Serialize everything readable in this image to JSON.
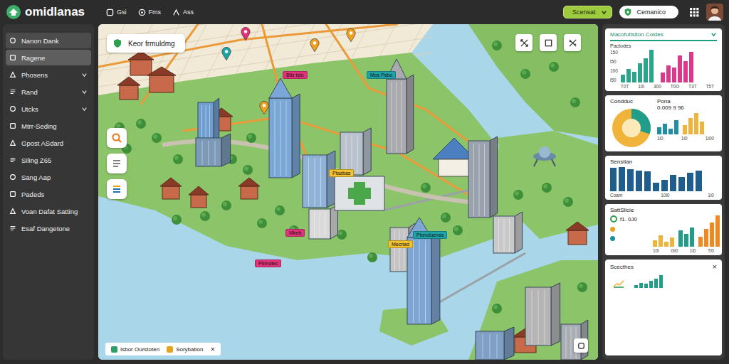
{
  "app": {
    "name": "omidlanas"
  },
  "nav": [
    {
      "label": "Gsi"
    },
    {
      "label": "Fms"
    },
    {
      "label": "Ass"
    }
  ],
  "header": {
    "scenario": {
      "label": "Scensat",
      "expanded": false
    },
    "status": "Cemanico"
  },
  "sidebar": {
    "items": [
      {
        "label": "Nanon Dank",
        "selected": false,
        "highlighted": true,
        "expandable": false
      },
      {
        "label": "Ragene",
        "selected": true,
        "highlighted": false,
        "expandable": false
      },
      {
        "label": "Phosens",
        "selected": false,
        "highlighted": false,
        "expandable": true
      },
      {
        "label": "Rand",
        "selected": false,
        "highlighted": false,
        "expandable": true
      },
      {
        "label": "Utcks",
        "selected": false,
        "highlighted": false,
        "expandable": true
      },
      {
        "label": "Mtrr-Seding",
        "selected": false,
        "highlighted": false,
        "expandable": false
      },
      {
        "label": "Gpost ASdard",
        "selected": false,
        "highlighted": false,
        "expandable": false
      },
      {
        "label": "Siling Z65",
        "selected": false,
        "highlighted": false,
        "expandable": false
      },
      {
        "label": "Sang Aap",
        "selected": false,
        "highlighted": false,
        "expandable": false
      },
      {
        "label": "Padeds",
        "selected": false,
        "highlighted": false,
        "expandable": false
      },
      {
        "label": "Voan Dafat Satting",
        "selected": false,
        "highlighted": false,
        "expandable": false
      },
      {
        "label": "Esaf Dangetone",
        "selected": false,
        "highlighted": false,
        "expandable": false
      }
    ]
  },
  "map": {
    "search": "Keor frmuldmg",
    "labels": [
      {
        "text": "Bitz tsio",
        "color": "#e0337a"
      },
      {
        "text": "Mos Psbo",
        "color": "#1fa3a8"
      },
      {
        "text": "Ptazbas",
        "color": "#f2c230"
      },
      {
        "text": "Mkeb",
        "color": "#e0337a"
      },
      {
        "text": "Pkrnolec",
        "color": "#e0337a"
      },
      {
        "text": "Pionoluenss",
        "color": "#1fa3a8"
      },
      {
        "text": "Mecnad",
        "color": "#f2c230"
      }
    ],
    "pins": [
      {
        "color": "#e0337a"
      },
      {
        "color": "#1fa3a8"
      },
      {
        "color": "#f0a020"
      },
      {
        "color": "#f0a020"
      },
      {
        "color": "#f0a020"
      }
    ],
    "legend": [
      {
        "label": "Isbor Ourstoten",
        "color": "#2e9e6a"
      },
      {
        "label": "Sorybation",
        "color": "#e8a21b"
      }
    ],
    "legend_close": "×"
  },
  "panels": {
    "overview": {
      "title": "Macofuttsiton Coldes",
      "expanded": false,
      "subtitle": "Pactodes",
      "y_ticks": [
        "150",
        "l50",
        "100",
        "l50"
      ],
      "x_ticks": [
        "T0T",
        "1I0",
        "300",
        "T0O",
        "T3T",
        "T5T"
      ],
      "series": [
        {
          "color": "#2aa58a",
          "values": [
            20,
            35,
            28,
            50,
            62,
            85
          ]
        },
        {
          "color": "#d93a8c",
          "values": [
            25,
            45,
            38,
            70,
            55,
            80
          ]
        }
      ]
    },
    "distribution": {
      "title": "Condduc",
      "donut": {
        "level": 0.3
      },
      "metric_label": "Pona",
      "metric_value": "0.009 9 96",
      "x_ticks": [
        "1l0",
        "1l0",
        "1l00"
      ],
      "series": [
        {
          "color": "#1f8fa5",
          "values": [
            30,
            45,
            25,
            60
          ]
        },
        {
          "color": "#f0b43a",
          "values": [
            40,
            70,
            90,
            55
          ]
        }
      ]
    },
    "sessions": {
      "title": "Senstian",
      "x_ticks": [
        "Coam",
        "10l0",
        "1l0"
      ],
      "series": [
        {
          "color": "#1f5e8c",
          "values": [
            80,
            82,
            76,
            70,
            68,
            30,
            40,
            55,
            48,
            62,
            70
          ]
        }
      ]
    },
    "statistics": {
      "title": "SattSlicie",
      "reading": {
        "text": "f1. 0J0",
        "color": "#2e9e4f"
      },
      "markers": [
        {
          "color": "#e8a21b"
        },
        {
          "color": "#1f8fa5"
        }
      ],
      "x_ticks": [
        "10l",
        "Gl0",
        "1l0",
        "Tl0"
      ],
      "series": [
        {
          "color": "#f0b43a",
          "values": [
            20,
            35,
            15,
            28
          ]
        },
        {
          "color": "#1f9e8a",
          "values": [
            50,
            40,
            60
          ]
        },
        {
          "color": "#f08a20",
          "values": [
            30,
            55,
            75,
            95
          ]
        }
      ]
    },
    "sketches": {
      "title": "Scecthes",
      "close": "×",
      "series": [
        {
          "color": "#1f9e8a",
          "values": [
            20,
            35,
            30,
            45,
            60,
            80
          ]
        }
      ]
    }
  }
}
